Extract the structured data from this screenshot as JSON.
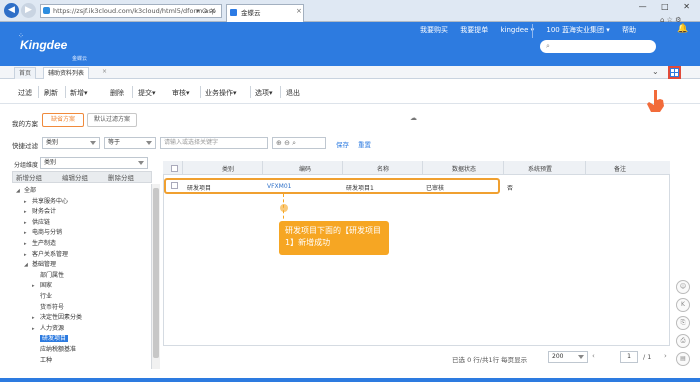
{
  "browser": {
    "url": "https://zsjf.ik3cloud.com/k3cloud/html5/dform.asp",
    "tab_title": "金蝶云",
    "window_controls": "— □ ✕",
    "tools": "⌂ ☆ ⚙"
  },
  "header": {
    "logo": "Kingdee",
    "logo_sub": "金蝶云",
    "nav": [
      "我要购买",
      "我要提单",
      "kingdee ▾",
      "100 蓝海实业集团 ▾",
      "帮助"
    ],
    "search_placeholder": ""
  },
  "app_tabs": [
    "首页",
    "辅助资料列表"
  ],
  "toolbar": [
    "过滤",
    "刷新",
    "新增▾",
    "删除",
    "提交▾",
    "审核▾",
    "业务操作▾",
    "选项▾",
    "退出"
  ],
  "scheme": {
    "label": "我的方案",
    "mine": "缺省方案",
    "default": "默认过滤方案"
  },
  "quick_filter": {
    "label": "快捷过滤",
    "field": "类别",
    "operator": "等于",
    "placeholder": "请输入或选择关键字",
    "save": "保存",
    "reset": "重置"
  },
  "group": {
    "label": "分组维度",
    "value": "类别",
    "buttons": [
      "新增分组",
      "编辑分组",
      "删除分组"
    ]
  },
  "tree": [
    {
      "label": "全部",
      "level": 0,
      "arrow": "◢"
    },
    {
      "label": "共享服务中心",
      "level": 1,
      "arrow": "▸"
    },
    {
      "label": "财务会计",
      "level": 1,
      "arrow": "▸"
    },
    {
      "label": "供应链",
      "level": 1,
      "arrow": "▸"
    },
    {
      "label": "电商与分销",
      "level": 1,
      "arrow": "▸"
    },
    {
      "label": "生产制造",
      "level": 1,
      "arrow": "▸"
    },
    {
      "label": "客户关系管理",
      "level": 1,
      "arrow": "▸"
    },
    {
      "label": "基础管理",
      "level": 1,
      "arrow": "◢"
    },
    {
      "label": "部门属性",
      "level": 2,
      "arrow": ""
    },
    {
      "label": "国家",
      "level": 2,
      "arrow": "▸"
    },
    {
      "label": "行业",
      "level": 2,
      "arrow": ""
    },
    {
      "label": "货币符号",
      "level": 2,
      "arrow": ""
    },
    {
      "label": "决定性因素分类",
      "level": 2,
      "arrow": "▸"
    },
    {
      "label": "人力资源",
      "level": 2,
      "arrow": "▸"
    },
    {
      "label": "研发项目",
      "level": 2,
      "arrow": ""
    },
    {
      "label": "应纳税额基准",
      "level": 2,
      "arrow": ""
    },
    {
      "label": "工种",
      "level": 2,
      "arrow": ""
    }
  ],
  "grid": {
    "columns": [
      "类别",
      "编码",
      "名称",
      "数据状态",
      "系统预置",
      "备注"
    ],
    "rows": [
      {
        "category": "研发项目",
        "code": "VFXM01",
        "name": "研发项目1",
        "status": "已审核",
        "preset": "否",
        "note": ""
      }
    ]
  },
  "tooltip": "研发项目下面的【研发项目1】新增成功",
  "footer": {
    "selected": "已选 0 行/共1行",
    "per_page_label": "每页显示",
    "per_page": "200",
    "page": "1",
    "total_pages": "/ 1"
  },
  "rail_icons": [
    "☺",
    "K",
    "⎘",
    "⎙",
    "▤"
  ]
}
